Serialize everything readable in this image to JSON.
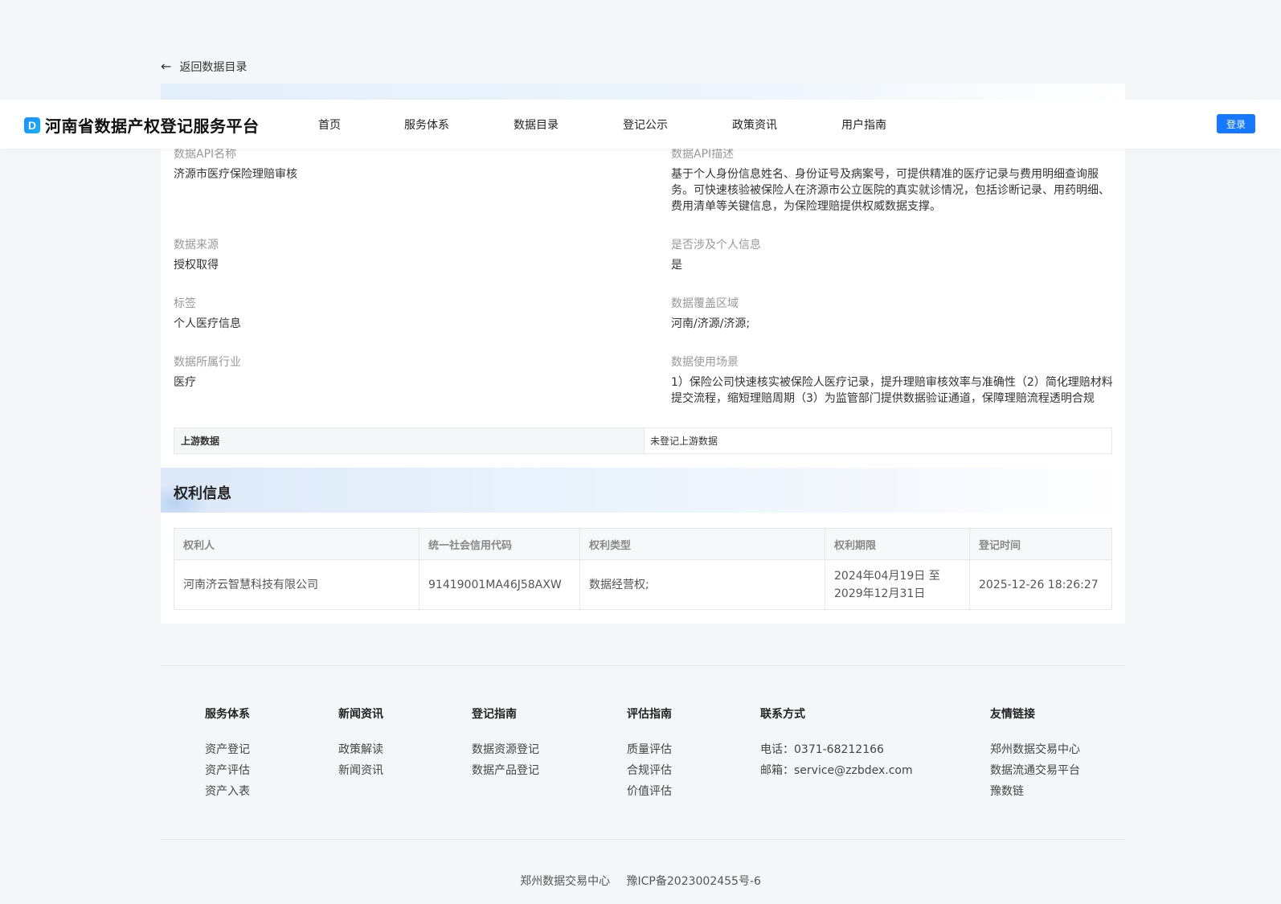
{
  "back": {
    "label": "返回数据目录"
  },
  "header": {
    "logo_text": "河南省数据产权登记服务平台",
    "nav": [
      "首页",
      "服务体系",
      "数据目录",
      "登记公示",
      "政策资讯",
      "用户指南"
    ],
    "login_label": "登录"
  },
  "fields": {
    "api_name_label": "数据API名称",
    "api_name_value": "济源市医疗保险理赔审核",
    "api_desc_label": "数据API描述",
    "api_desc_value": "基于个人身份信息姓名、身份证号及病案号，可提供精准的医疗记录与费用明细查询服务。可快速核验被保险人在济源市公立医院的真实就诊情况，包括诊断记录、用药明细、费用清单等关键信息，为保险理赔提供权威数据支撑。",
    "source_label": "数据来源",
    "source_value": "授权取得",
    "personal_label": "是否涉及个人信息",
    "personal_value": "是",
    "tag_label": "标签",
    "tag_value": "个人医疗信息",
    "region_label": "数据覆盖区域",
    "region_value": "河南/济源/济源;",
    "industry_label": "数据所属行业",
    "industry_value": "医疗",
    "scenario_label": "数据使用场景",
    "scenario_value": "1）保险公司快速核实被保险人医疗记录，提升理赔审核效率与准确性（2）简化理赔材料提交流程，缩短理赔周期（3）为监管部门提供数据验证通道，保障理赔流程透明合规"
  },
  "upstream": {
    "label": "上游数据",
    "value": "未登记上游数据"
  },
  "rights": {
    "title": "权利信息",
    "columns": [
      "权利人",
      "统一社会信用代码",
      "权利类型",
      "权利期限",
      "登记时间"
    ],
    "rows": [
      [
        "河南济云智慧科技有限公司",
        "91419001MA46J58AXW",
        "数据经营权;",
        "2024年04月19日 至 2029年12月31日",
        "2025-12-26 18:26:27"
      ]
    ]
  },
  "footer": {
    "service": {
      "title": "服务体系",
      "links": [
        "资产登记",
        "资产评估",
        "资产入表"
      ]
    },
    "news": {
      "title": "新闻资讯",
      "links": [
        "政策解读",
        "新闻资讯"
      ]
    },
    "reg_guide": {
      "title": "登记指南",
      "links": [
        "数据资源登记",
        "数据产品登记"
      ]
    },
    "eval_guide": {
      "title": "评估指南",
      "links": [
        "质量评估",
        "合规评估",
        "价值评估"
      ]
    },
    "contact": {
      "title": "联系方式",
      "phone": "电话：0371-68212166",
      "email": "邮箱：service@zzbdex.com"
    },
    "friends": {
      "title": "友情链接",
      "links": [
        "郑州数据交易中心",
        "数据流通交易平台",
        "豫数链"
      ]
    },
    "copyright_org": "郑州数据交易中心",
    "icp": "豫ICP备2023002455号-6"
  },
  "colors": {
    "accent": "#1677ff",
    "background": "#f4f6fa"
  },
  "icons": {
    "back": "arrow-left-icon",
    "logo": "logo-icon"
  }
}
